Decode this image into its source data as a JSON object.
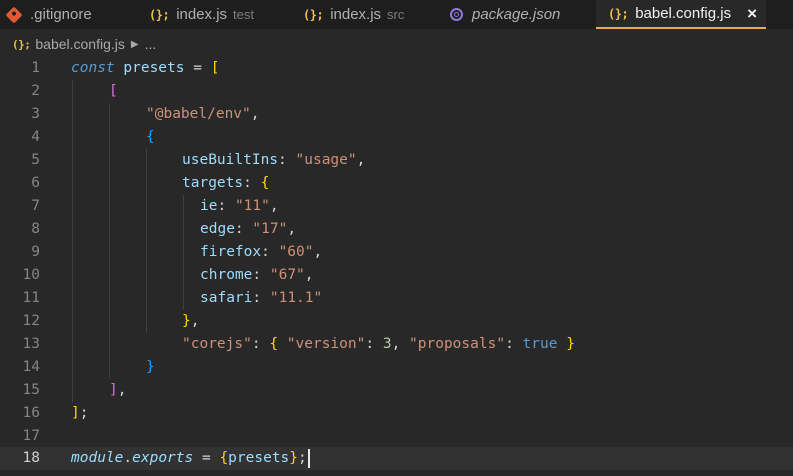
{
  "tabs": [
    {
      "label": ".gitignore",
      "desc": "",
      "icon": "git-icon",
      "active": false
    },
    {
      "label": "index.js",
      "desc": "test",
      "icon": "js-icon",
      "active": false
    },
    {
      "label": "index.js",
      "desc": "src",
      "icon": "js-icon",
      "active": false
    },
    {
      "label": "package.json",
      "desc": "",
      "icon": "package-icon",
      "active": false
    },
    {
      "label": "babel.config.js",
      "desc": "",
      "icon": "js-icon",
      "active": true
    }
  ],
  "icons": {
    "js_glyph": "(};",
    "close_glyph": "×",
    "chevron_glyph": "▶"
  },
  "breadcrumb": {
    "file": "babel.config.js",
    "more": "..."
  },
  "line_numbers": [
    "1",
    "2",
    "3",
    "4",
    "5",
    "6",
    "7",
    "8",
    "9",
    "10",
    "11",
    "12",
    "13",
    "14",
    "15",
    "16",
    "17",
    "18"
  ],
  "code": {
    "l1": [
      "const",
      "presets",
      "=",
      "["
    ],
    "l2": [
      "["
    ],
    "l3": [
      "\"@babel/env\"",
      ","
    ],
    "l4": [
      "{"
    ],
    "l5": [
      "useBuiltIns",
      ": ",
      "\"usage\"",
      ","
    ],
    "l6": [
      "targets",
      ": ",
      "{"
    ],
    "l7": [
      "ie",
      ": ",
      "\"11\"",
      ","
    ],
    "l8": [
      "edge",
      ": ",
      "\"17\"",
      ","
    ],
    "l9": [
      "firefox",
      ": ",
      "\"60\"",
      ","
    ],
    "l10": [
      "chrome",
      ": ",
      "\"67\"",
      ","
    ],
    "l11": [
      "safari",
      ": ",
      "\"11.1\""
    ],
    "l12": [
      "}",
      ","
    ],
    "l13": [
      "\"corejs\"",
      ": ",
      "{",
      " ",
      "\"version\"",
      ": ",
      "3",
      ", ",
      "\"proposals\"",
      ": ",
      "true",
      " ",
      "}"
    ],
    "l14": [
      "}"
    ],
    "l15": [
      "]",
      ","
    ],
    "l16": [
      "]",
      ";"
    ],
    "l18": [
      "module",
      ".",
      "exports",
      " = ",
      "{",
      "presets",
      "}",
      ";"
    ]
  },
  "colors": {
    "accent": "#e8ab53",
    "background": "#282828",
    "tabbar": "#1e1e1e"
  }
}
